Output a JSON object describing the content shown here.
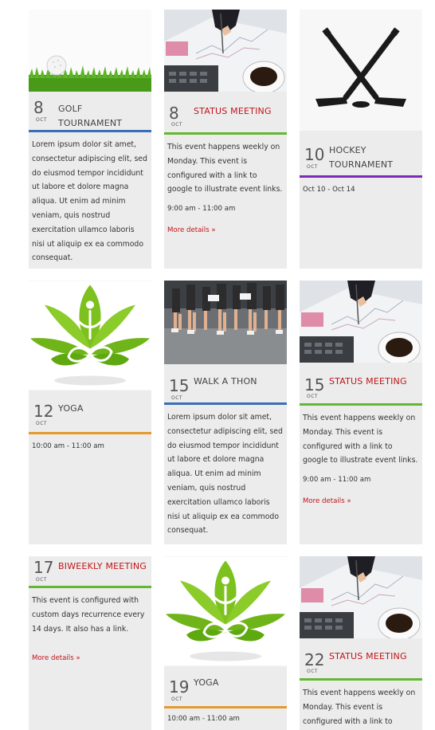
{
  "events": [
    {
      "day": "8",
      "month": "OCT",
      "title": "GOLF TOURNAMENT",
      "desc": "Lorem ipsum dolor sit amet, consectetur adipiscing elit, sed do eiusmod tempor incididunt ut labore et dolore magna aliqua. Ut enim ad minim veniam, quis nostrud exercitation ullamco laboris nisi ut aliquip ex ea commodo consequat.",
      "time": "",
      "more": "",
      "color": "#3a6fb8"
    },
    {
      "day": "8",
      "month": "OCT",
      "title": "STATUS MEETING",
      "desc": "This event happens weekly on Monday. This event is configured with a link to google to illustrate event links.",
      "time": "9:00 am - 11:00 am",
      "more": "More details »",
      "color": "#62b832"
    },
    {
      "day": "10",
      "month": "OCT",
      "title": "HOCKEY TOURNAMENT",
      "desc": "",
      "time": "Oct 10 - Oct 14",
      "more": "",
      "color": "#7d2ab8"
    },
    {
      "day": "12",
      "month": "OCT",
      "title": "YOGA",
      "desc": "",
      "time": "10:00 am - 11:00 am",
      "more": "",
      "color": "#e49a2e"
    },
    {
      "day": "15",
      "month": "OCT",
      "title": "WALK A THON",
      "desc": "Lorem ipsum dolor sit amet, consectetur adipiscing elit, sed do eiusmod tempor incididunt ut labore et dolore magna aliqua. Ut enim ad minim veniam, quis nostrud exercitation ullamco laboris nisi ut aliquip ex ea commodo consequat.",
      "time": "",
      "more": "",
      "color": "#3a6fb8"
    },
    {
      "day": "15",
      "month": "OCT",
      "title": "STATUS MEETING",
      "desc": "This event happens weekly on Monday. This event is configured with a link to google to illustrate event links.",
      "time": "9:00 am - 11:00 am",
      "more": "More details »",
      "color": "#62b832"
    },
    {
      "day": "17",
      "month": "OCT",
      "title": "BIWEEKLY MEETING",
      "desc": "This event is configured with custom days recurrence every 14 days. It also has a link.",
      "time": "",
      "more": "More details »",
      "color": "#62b832"
    },
    {
      "day": "19",
      "month": "OCT",
      "title": "YOGA",
      "desc": "",
      "time": "10:00 am - 11:00 am",
      "more": "",
      "color": "#e49a2e"
    },
    {
      "day": "22",
      "month": "OCT",
      "title": "STATUS MEETING",
      "desc": "This event happens weekly on Monday. This event is configured with a link to",
      "time": "",
      "more": "",
      "color": "#62b832"
    }
  ]
}
